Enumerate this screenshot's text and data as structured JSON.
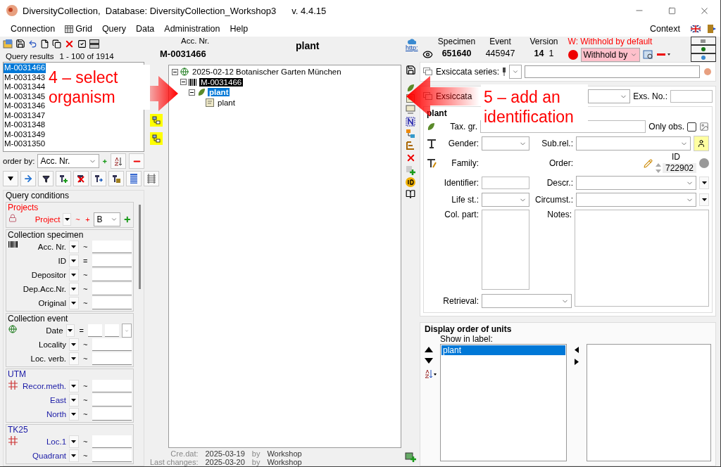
{
  "window": {
    "title": "DiversityCollection,  Database: DiversityCollection_Workshop3",
    "version": "v. 4.4.15"
  },
  "menu": [
    {
      "label": "Connection",
      "kind": "plain"
    },
    {
      "label": "Grid",
      "kind": "grid"
    },
    {
      "label": "Query",
      "kind": "plain"
    },
    {
      "label": "Data",
      "kind": "plain"
    },
    {
      "label": "Administration",
      "kind": "plain"
    },
    {
      "label": "Help",
      "kind": "plain"
    }
  ],
  "context_menu": "Context",
  "query_results": {
    "title": "Query results",
    "range": "1 - 100 of 1914",
    "items": [
      {
        "label": "M-0031466",
        "selected": true
      },
      {
        "label": "M-0031343",
        "selected": false
      },
      {
        "label": "M-0031344",
        "selected": false
      },
      {
        "label": "M-0031345",
        "selected": false
      },
      {
        "label": "M-0031346",
        "selected": false
      },
      {
        "label": "M-0031347",
        "selected": false
      },
      {
        "label": "M-0031348",
        "selected": false
      },
      {
        "label": "M-0031349",
        "selected": false
      },
      {
        "label": "M-0031350",
        "selected": false
      }
    ],
    "order_by_label": "order by:",
    "order_by_value": "Acc. Nr."
  },
  "query_conditions": {
    "title": "Query conditions",
    "groups": [
      {
        "title": "Projects",
        "kind": "projects",
        "color": "#ff0000",
        "rows": [
          {
            "kind": "project",
            "label": "Project",
            "operator": "~",
            "extra": "+",
            "value": "B"
          }
        ]
      },
      {
        "title": "Collection specimen",
        "kind": "specimen",
        "color": "#000000",
        "rows": [
          {
            "kind": "text",
            "label": "Acc. Nr.",
            "operator": "~"
          },
          {
            "kind": "text",
            "label": "ID",
            "operator": "="
          },
          {
            "kind": "text",
            "label": "Depositor",
            "operator": "~"
          },
          {
            "kind": "text",
            "label": "Dep.Acc.Nr.",
            "operator": "~"
          },
          {
            "kind": "text",
            "label": "Original",
            "operator": "~"
          }
        ]
      },
      {
        "title": "Collection event",
        "kind": "event",
        "color": "#000000",
        "rows": [
          {
            "kind": "date",
            "label": "Date",
            "operator": "="
          },
          {
            "kind": "text",
            "label": "Locality",
            "operator": "~"
          },
          {
            "kind": "text",
            "label": "Loc. verb.",
            "operator": "~"
          }
        ]
      },
      {
        "title": "UTM",
        "kind": "utm",
        "color": "#1a1aa6",
        "rows": [
          {
            "kind": "text",
            "label": "Recor.meth.",
            "operator": "~"
          },
          {
            "kind": "text",
            "label": "East",
            "operator": "~"
          },
          {
            "kind": "text",
            "label": "North",
            "operator": "~"
          }
        ]
      },
      {
        "title": "TK25",
        "kind": "tk25",
        "color": "#1a1aa6",
        "rows": [
          {
            "kind": "text",
            "label": "Loc.1",
            "operator": "~"
          },
          {
            "kind": "text",
            "label": "Quadrant",
            "operator": "~"
          }
        ]
      }
    ]
  },
  "tree_header": {
    "acc_label": "Acc. Nr.",
    "acc_value": "M-0031466",
    "title": "plant"
  },
  "tree": [
    {
      "label": "2025-02-12 Botanischer Garten München",
      "kind": "event",
      "selected": false,
      "expanded": true,
      "children": [
        {
          "label": "M-0031466",
          "kind": "specimen",
          "selected": false,
          "expanded": true,
          "children": [
            {
              "label": "plant",
              "kind": "unit",
              "selected": true,
              "expanded": true,
              "children": [
                {
                  "label": "plant",
                  "kind": "identification",
                  "selected": false
                }
              ]
            }
          ]
        }
      ]
    }
  ],
  "record_info": [
    {
      "label": "Cre.dat:",
      "date": "2025-03-19",
      "by": "by",
      "user": "Workshop"
    },
    {
      "label": "Last changes:",
      "date": "2025-03-20",
      "by": "by",
      "user": "Workshop"
    }
  ],
  "record_header": {
    "link": "http:",
    "columns": [
      {
        "label": "Specimen",
        "value": "651640",
        "kind": "bold"
      },
      {
        "label": "Event",
        "value": "445947",
        "kind": "plain"
      },
      {
        "label": "Version",
        "value": "14",
        "value2": "1",
        "kind": "version"
      }
    ],
    "withhold_label": "W: Withhold by default",
    "withhold_value": "Withhold by"
  },
  "exsiccata": {
    "series_label": "Exsiccata series:",
    "label": "Exsiccata",
    "number_label": "Exs. No.:"
  },
  "unit": {
    "title": "plant",
    "tax_label": "Tax. gr.",
    "only_obs_label": "Only obs.",
    "only_obs_checked": false,
    "gender_label": "Gender:",
    "subrel_label": "Sub.rel.:",
    "family_label": "Family:",
    "order_label": "Order:",
    "id_label": "ID",
    "id_value": "722902",
    "identifier_label": "Identifier:",
    "descr_label": "Descr.:",
    "life_label": "Life st.:",
    "circ_label": "Circumst.:",
    "colpart_label": "Col. part:",
    "notes_label": "Notes:",
    "retrieval_label": "Retrieval:"
  },
  "display_order": {
    "title": "Display order of units",
    "show_label": "Show in label:",
    "items": [
      {
        "label": "plant",
        "selected": true
      }
    ]
  },
  "annotations": [
    {
      "text": "4 – select organism",
      "kind": "arrow-right"
    },
    {
      "text": "5 – add an identification",
      "kind": "arrow-left"
    }
  ]
}
